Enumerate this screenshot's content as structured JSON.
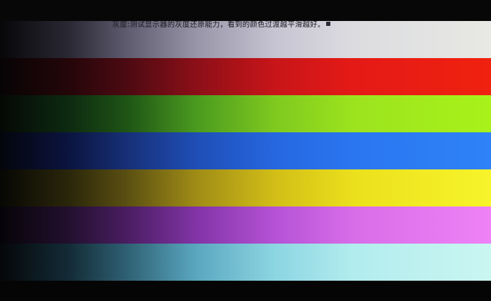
{
  "screen": {
    "caption": "灰度:测试显示器的灰度还原能力，看到的颜色过渡越平滑越好。",
    "bands": [
      {
        "name": "gray",
        "color": "#e8e9e4"
      },
      {
        "name": "red",
        "color": "#f0210f"
      },
      {
        "name": "green",
        "color": "#a8f21a"
      },
      {
        "name": "blue",
        "color": "#2f82f7"
      },
      {
        "name": "yellow",
        "color": "#f7f42b"
      },
      {
        "name": "purple",
        "color": "#ee82f6"
      },
      {
        "name": "cyan",
        "color": "#caf6f1"
      }
    ]
  }
}
